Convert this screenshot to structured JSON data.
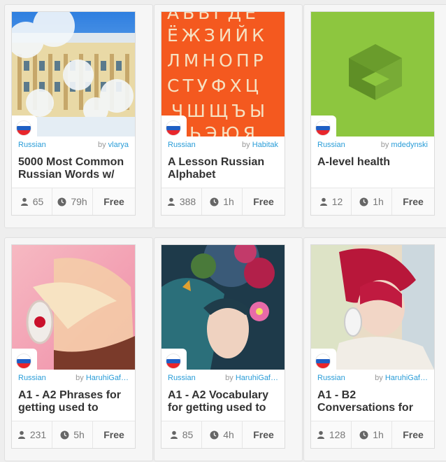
{
  "cards": [
    {
      "language": "Russian",
      "by": "by",
      "author": "vlarya",
      "title": "5000 Most Common Russian Words w/",
      "learners": "65",
      "time": "79h",
      "price": "Free",
      "image": "winter-palace-photo"
    },
    {
      "language": "Russian",
      "by": "by",
      "author": "Habitak",
      "title": "A Lesson Russian Alphabet",
      "learners": "388",
      "time": "1h",
      "price": "Free",
      "image": "cyrillic-alphabet-poster",
      "alphabet_rows": [
        "АБВГДЕ",
        "ЁЖЗИЙК",
        "ЛМНОПР",
        "СТУФХЦ",
        "ЧШЩЪЫ",
        "ЬЭЮЯ"
      ]
    },
    {
      "language": "Russian",
      "by": "by",
      "author": "mdedynski",
      "title": "A-level health",
      "learners": "12",
      "time": "1h",
      "price": "Free",
      "image": "green-memrise-logo"
    },
    {
      "language": "Russian",
      "by": "by",
      "author": "HaruhiGaf…",
      "title": "A1 - A2 Phrases for getting used to",
      "learners": "231",
      "time": "5h",
      "price": "Free",
      "image": "girl-headphones-pink"
    },
    {
      "language": "Russian",
      "by": "by",
      "author": "HaruhiGaf…",
      "title": "A1 - A2 Vocabulary for getting used to",
      "learners": "85",
      "time": "4h",
      "price": "Free",
      "image": "fantasy-girl-flowers"
    },
    {
      "language": "Russian",
      "by": "by",
      "author": "HaruhiGaf…",
      "title": "A1 - B2 Conversations for",
      "learners": "128",
      "time": "1h",
      "price": "Free",
      "image": "redhead-headphones"
    }
  ],
  "icons": {
    "learners": "user-icon",
    "time": "clock-icon",
    "flag": "russian-flag-icon"
  },
  "colors": {
    "link": "#2a9dd8",
    "flag_white": "#ffffff",
    "flag_blue": "#1f5fc4",
    "flag_red": "#e8262b"
  }
}
